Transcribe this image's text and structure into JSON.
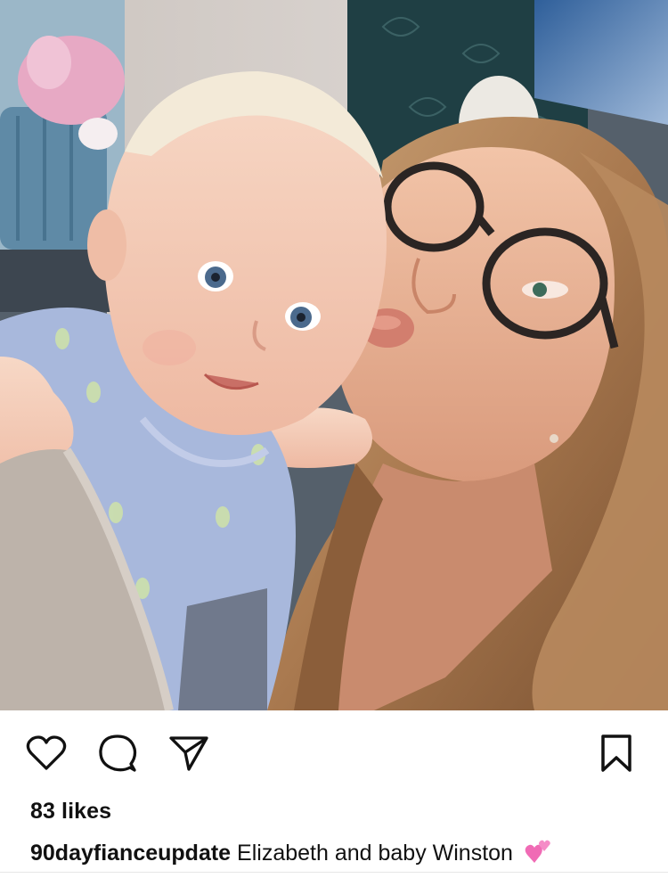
{
  "post": {
    "photo_alt": "",
    "likes_text": "83 likes",
    "caption": {
      "username": "90dayfianceupdate",
      "text": "Elizabeth and baby Winston",
      "emoji": "two-hearts-emoji"
    },
    "icons": {
      "like": "heart-outline-icon",
      "comment": "comment-bubble-icon",
      "share": "paper-plane-icon",
      "save": "bookmark-icon"
    },
    "colors": {
      "text": "#111111",
      "emoji_pink": "#f06bb5"
    }
  }
}
